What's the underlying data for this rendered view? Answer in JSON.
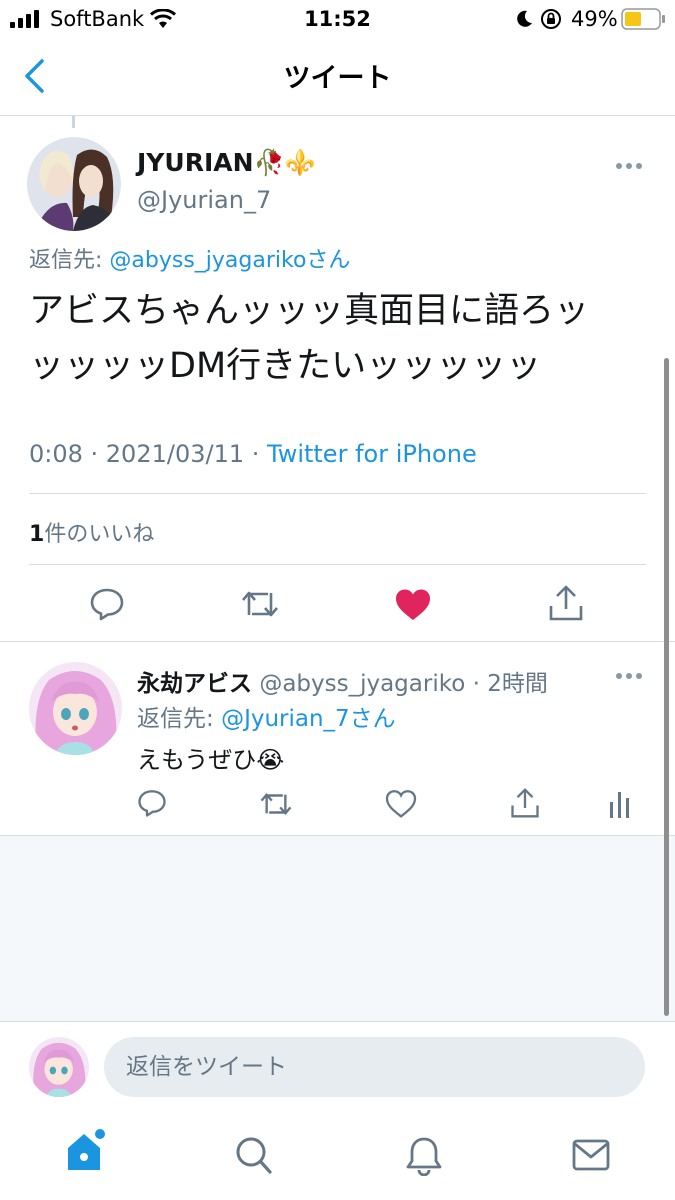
{
  "status_bar": {
    "carrier": "SoftBank",
    "time": "11:52",
    "battery": "49%"
  },
  "nav": {
    "title": "ツイート"
  },
  "main_tweet": {
    "display_name": "JYURIAN",
    "name_emojis": "🥀⚜️",
    "handle": "@Jyurian_7",
    "reply_to_prefix": "返信先: ",
    "reply_to_handle": "@abyss_jyagarikoさん",
    "text_line1": "アビスちゃんッッッ真面目に語ろッ",
    "text_line2": "ッッッッDM行きたいッッッッッ",
    "timestamp": "0:08 · 2021/03/11 · ",
    "source": "Twitter for iPhone",
    "likes_count": "1",
    "likes_label": "件のいいね",
    "liked": true,
    "like_color": "#e0245e"
  },
  "reply_tweet": {
    "display_name": "永劫アビス",
    "handle": "@abyss_jyagariko",
    "time_ago": "· 2時間",
    "reply_to_prefix": "返信先: ",
    "reply_to_handle": "@Jyurian_7さん",
    "text": "えもうぜひ😭"
  },
  "compose": {
    "placeholder": "返信をツイート"
  },
  "colors": {
    "accent": "#1b95e0",
    "muted": "#657786"
  }
}
